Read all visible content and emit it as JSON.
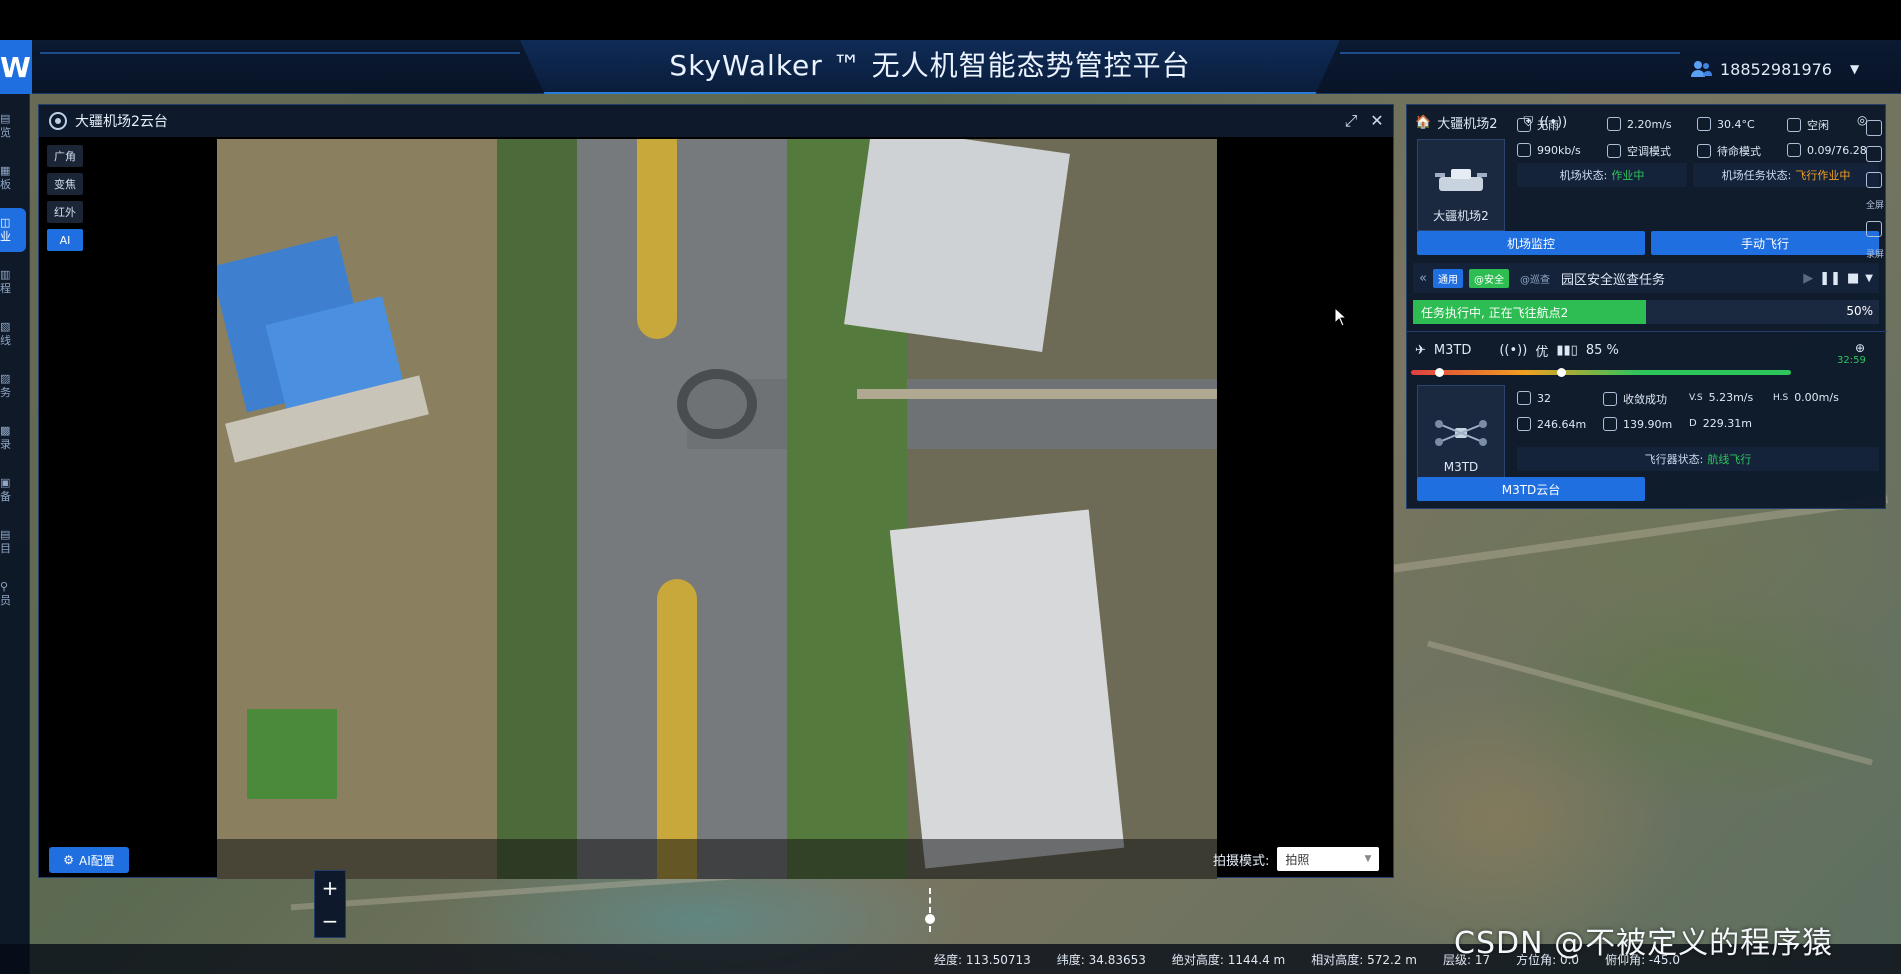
{
  "header": {
    "logo": "W",
    "title": "SkyWalker ™ 无人机智能态势管控平台",
    "user": "18852981976"
  },
  "left_rail": [
    "览",
    "板",
    "业",
    "程",
    "线",
    "务",
    "录",
    "备",
    "目",
    "员"
  ],
  "video_window": {
    "title": "大疆机场2云台",
    "modes": [
      "广角",
      "变焦",
      "红外",
      "AI"
    ],
    "ai_config": "AI配置",
    "shoot_mode_label": "拍摄模式:",
    "shoot_mode_value": "拍照"
  },
  "dock": {
    "name": "大疆机场2",
    "thumb_label": "大疆机场2",
    "stats": {
      "rain": "无雨",
      "wind": "2.20m/s",
      "temp": "30.4°C",
      "space": "空闲",
      "net": "990kb/s",
      "air": "空调模式",
      "standby": "待命模式",
      "storage": "0.09/76.28"
    },
    "dock_status_label": "机场状态:",
    "dock_status_value": "作业中",
    "task_status_label": "机场任务状态:",
    "task_status_value": "飞行作业中",
    "btn_monitor": "机场监控",
    "btn_manual": "手动飞行"
  },
  "task": {
    "tag1": "通用",
    "tag2": "@安全",
    "tag3": "@巡查",
    "name": "园区安全巡查任务",
    "progress_text": "任务执行中, 正在飞往航点2",
    "progress_pct": "50%",
    "progress_value": 0.5
  },
  "drone": {
    "name": "M3TD",
    "signal": "优",
    "battery": "85 %",
    "time": "32:59",
    "thumb_label": "M3TD",
    "stats": {
      "sats": "32",
      "rtk": "收敛成功",
      "vs_label": "V.S",
      "vs": "5.23m/s",
      "hs_label": "H.S",
      "hs": "0.00m/s",
      "alt": "246.64m",
      "rel": "139.90m",
      "d_label": "D",
      "dist": "229.31m"
    },
    "status_label": "飞行器状态:",
    "status_value": "航线飞行",
    "btn_gimbal": "M3TD云台"
  },
  "side_labels": [
    "全屏",
    "录屏"
  ],
  "map_status": {
    "lng": "经度: 113.50713",
    "lat": "纬度: 34.83653",
    "abs_alt": "绝对高度: 1144.4 m",
    "rel_alt": "相对高度: 572.2 m",
    "level": "层级: 17",
    "azimuth": "方位角: 0.0",
    "pitch": "俯仰角: -45.0"
  },
  "watermark": "CSDN @不被定义的程序猿",
  "colors": {
    "accent": "#1f6fe0",
    "success": "#2ebd52",
    "warn": "#f0a020",
    "panel": "#0a1628"
  }
}
